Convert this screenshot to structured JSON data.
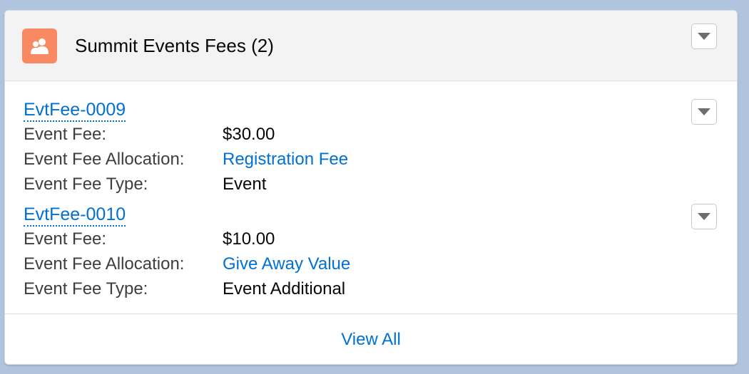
{
  "card": {
    "title": "Summit Events Fees (2)",
    "icon": "user-group-icon",
    "accent_color": "#f88962",
    "footer_link": "View All"
  },
  "records": [
    {
      "name": "EvtFee-0009",
      "fields": [
        {
          "label": "Event Fee:",
          "value": "$30.00",
          "is_link": false
        },
        {
          "label": "Event Fee Allocation:",
          "value": "Registration Fee",
          "is_link": true
        },
        {
          "label": "Event Fee Type:",
          "value": "Event",
          "is_link": false
        }
      ]
    },
    {
      "name": "EvtFee-0010",
      "fields": [
        {
          "label": "Event Fee:",
          "value": "$10.00",
          "is_link": false
        },
        {
          "label": "Event Fee Allocation:",
          "value": "Give Away Value",
          "is_link": true
        },
        {
          "label": "Event Fee Type:",
          "value": "Event Additional",
          "is_link": false
        }
      ]
    }
  ]
}
